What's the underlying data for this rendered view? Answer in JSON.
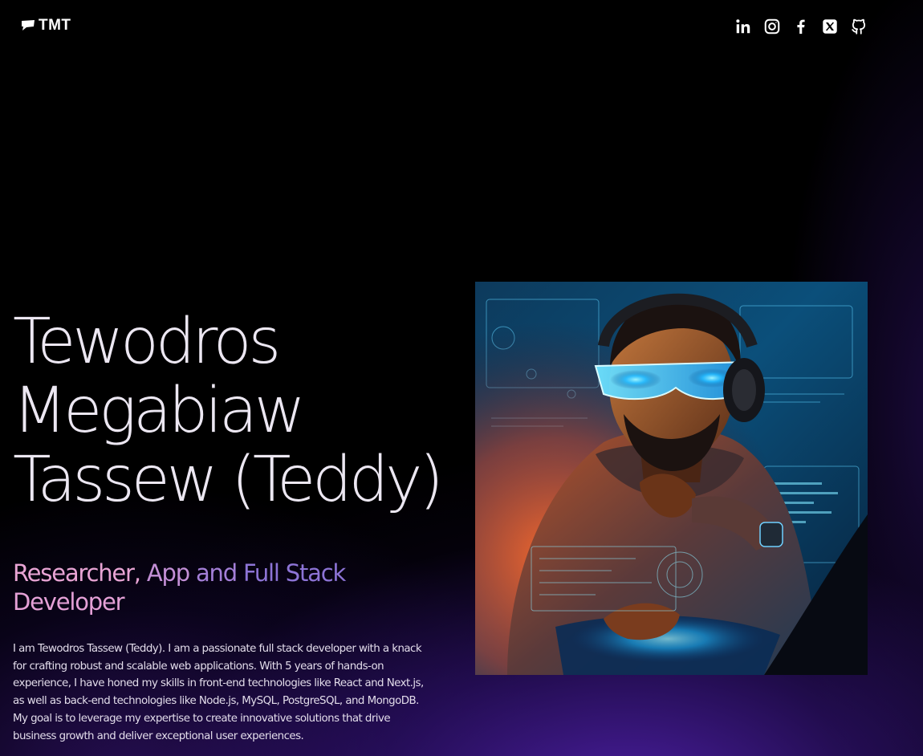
{
  "header": {
    "logo_text": "TMT",
    "logo_icon": "speech-flag-icon",
    "socials": [
      {
        "name": "linkedin",
        "icon": "linkedin-icon"
      },
      {
        "name": "instagram",
        "icon": "instagram-icon"
      },
      {
        "name": "facebook",
        "icon": "facebook-icon"
      },
      {
        "name": "x",
        "icon": "x-icon"
      },
      {
        "name": "github",
        "icon": "github-icon"
      }
    ]
  },
  "hero": {
    "name_lines": [
      "Tewodros",
      "Megabiaw",
      "Tassew (Teddy)"
    ],
    "role_words": [
      "Researcher,",
      "App",
      "and",
      "Full Stack",
      "Developer"
    ],
    "bio": "I am Tewodros Tassew (Teddy). I am a passionate full stack developer with a knack for crafting robust and scalable web applications. With 5 years of hands-on experience, I have honed my skills in front-end technologies like React and Next.js, as well as back-end technologies like Node.js, MySQL, PostgreSQL, and MongoDB. My goal is to leverage my expertise to create innovative solutions that drive business growth and deliver exceptional user experiences.",
    "image_alt": "Portrait illustration of a developer wearing glowing glasses and headphones at a laptop"
  },
  "colors": {
    "background": "#000000",
    "accent_purple": "#5824be",
    "role_pink": "#e8a4d4",
    "role_violet": "#8d74d6",
    "name_text": "#ece7f2"
  }
}
